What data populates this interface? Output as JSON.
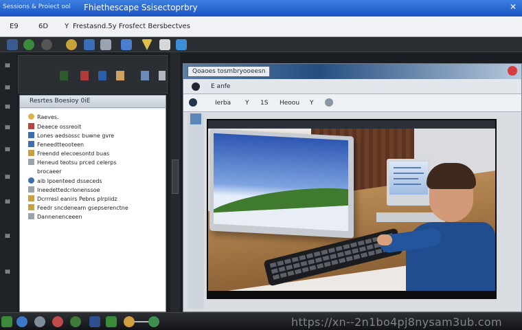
{
  "window": {
    "left_label": "Sessions & Proiect ool",
    "title": "Fhiethescape Ssisectoprbry",
    "close": "✕"
  },
  "menubar": {
    "items": [
      "E9",
      "6D",
      "Y",
      "Frestasnd.5y Frosfect Bersbectves"
    ]
  },
  "pane": {
    "header": "Resrtes Boesioy 0iE",
    "items": [
      "Raeves.",
      "Deaece ossreoit",
      "Lones aedsossc buwne gvre",
      "Feneedtteooteen",
      "Freendd elecoesontd buas",
      "Heneud teotsu prced celerps",
      "brocaeer",
      "aib Ipoenteed dsseceds",
      "Ineedettedcrlonenssoe",
      "Dcrrresl eanirs Pebns plrplidz",
      "Feedr sncdeneam gsepserenctne",
      "Dannenenceeen"
    ]
  },
  "media": {
    "title": "Qoaoes tosmbryooeesn",
    "bar1": "E anfe",
    "bar2_items": [
      "Ierba",
      "Y",
      "1S",
      "Heoou",
      "Y"
    ]
  },
  "taskbar": {
    "watermark": "https://xn--2n1bo4pj8nysam3ub.com"
  },
  "colors": {
    "titlebar": "#1a54c4",
    "taskbar": "#121417",
    "pane_bg": "#ffffff"
  }
}
